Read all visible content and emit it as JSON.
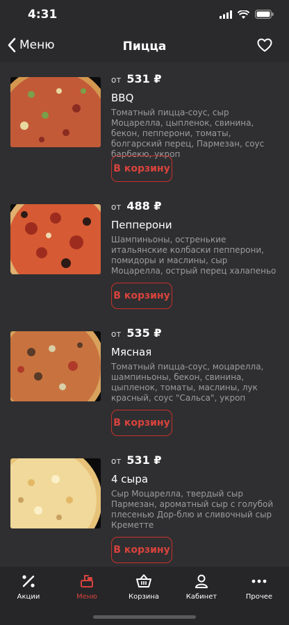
{
  "status": {
    "time": "4:31"
  },
  "nav": {
    "back_label": "Меню",
    "title": "Пицца"
  },
  "currency": "₽",
  "products": [
    {
      "price_prefix": "от",
      "price": "531 ₽",
      "name": "BBQ",
      "description": "Томатный пицца-соус, сыр Моцарелла, цыпленок, свинина, бекон, пепперони, томаты, болгарский перец, Пармезан, соус барбекю, укроп",
      "cart_label": "В корзину"
    },
    {
      "price_prefix": "от",
      "price": "488 ₽",
      "name": "Пепперони",
      "description": "Шампиньоны, остренькие итальянские колбаски пепперони, помидоры и маслины, сыр Моцарелла, острый перец халапеньо",
      "cart_label": "В корзину"
    },
    {
      "price_prefix": "от",
      "price": "535 ₽",
      "name": "Мясная",
      "description": "Томатный пицца-соус, моцарелла, шампиньоны, бекон, свинина, цыпленок, томаты, маслины, лук красный, соус \"Сальса\", укроп",
      "cart_label": "В корзину"
    },
    {
      "price_prefix": "от",
      "price": "531 ₽",
      "name": "4 сыра",
      "description": "Сыр Моцарелла, твердый сыр Пармезан, ароматный сыр с голубой плесенью Дор-блю и сливочный сыр Креметте",
      "cart_label": "В корзину"
    }
  ],
  "tabs": [
    {
      "label": "Акции",
      "icon": "percent-icon",
      "active": false
    },
    {
      "label": "Меню",
      "icon": "menu-icon",
      "active": true
    },
    {
      "label": "Корзина",
      "icon": "basket-icon",
      "active": false
    },
    {
      "label": "Кабинет",
      "icon": "user-icon",
      "active": false
    },
    {
      "label": "Прочее",
      "icon": "more-icon",
      "active": false
    }
  ],
  "colors": {
    "accent": "#d9433d",
    "background": "#2f2f31",
    "text_secondary": "#9c9c9e"
  }
}
